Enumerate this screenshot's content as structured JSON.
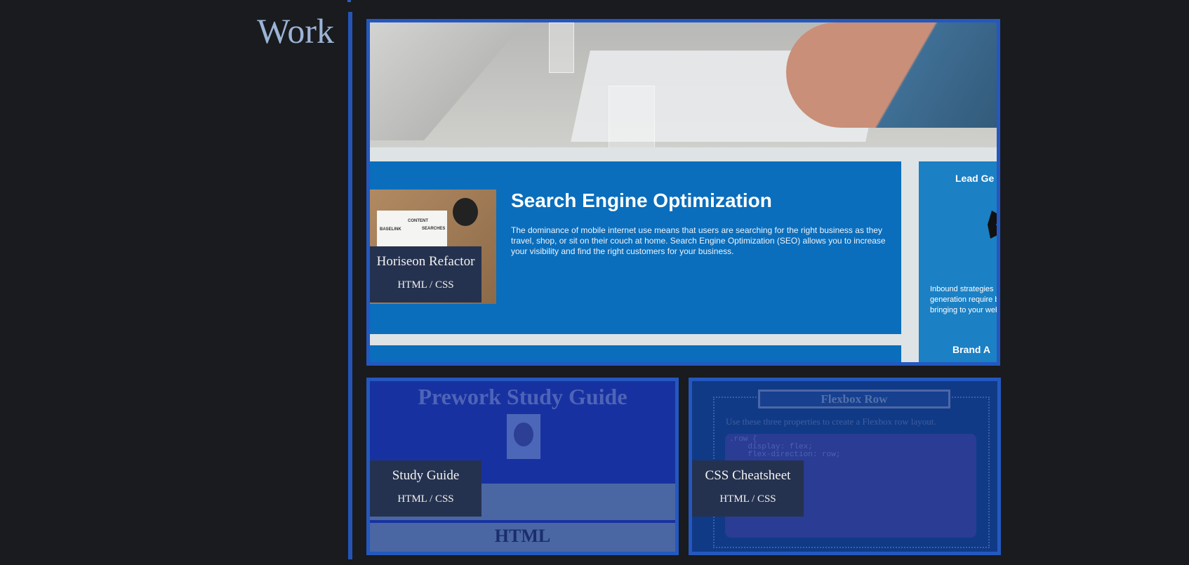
{
  "section": {
    "title": "Work"
  },
  "projects": [
    {
      "title": "Horiseon Refactor",
      "tech": "HTML / CSS",
      "preview": {
        "seo_heading": "Search Engine Optimization",
        "seo_body": "The dominance of mobile internet use means that users are searching for the right business as they travel, shop, or sit on their couch at home. Search Engine Optimization (SEO) allows you to increase your visibility and find the right customers for your business.",
        "lead_title": "Lead Ge",
        "lead_body": "Inbound strategies generation require business, bringing to your website.",
        "brand_title": "Brand A",
        "thumb_note_1": "CONTENT",
        "thumb_note_2": "BASELINK",
        "thumb_note_3": "SEARCHES"
      }
    },
    {
      "title": "Study Guide",
      "tech": "HTML / CSS",
      "preview": {
        "heading": "Prework Study Guide",
        "band_text": "HTML"
      }
    },
    {
      "title": "CSS Cheatsheet",
      "tech": "HTML / CSS",
      "preview": {
        "heading": "Flexbox Row",
        "desc": "Use these three properties to create a Flexbox row layout.",
        "code": ".row {\n    display: flex;\n    flex-direction: row;"
      }
    }
  ],
  "colors": {
    "background": "#1a1b1e",
    "accent": "#2458c0",
    "label_bg": "#25324f",
    "title": "#9cb4d6"
  }
}
